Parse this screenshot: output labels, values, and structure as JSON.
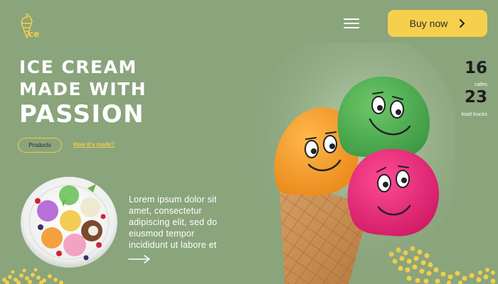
{
  "header": {
    "logo_text": "ce",
    "menu_icon": "hamburger-menu-icon",
    "buy_label": "Buy now",
    "buy_icon": "chevron-right-icon"
  },
  "hero": {
    "title_line1": "ICE CREAM",
    "title_line2": "MADE WITH",
    "title_line3": "PASSION",
    "products_label": "Products",
    "how_label": "How it's made?"
  },
  "stats": [
    {
      "value": "16",
      "label": "cafes"
    },
    {
      "value": "23",
      "label": "food trucks"
    }
  ],
  "description": "Lorem ipsum dolor sit amet, consectetur adipiscing elit, sed do eiusmod tempor incididunt ut labore et",
  "arrow_icon": "arrow-right-icon",
  "colors": {
    "background": "#8aa47c",
    "accent_yellow": "#f6d04d",
    "scoop_orange": "#f5a02c",
    "scoop_green": "#56b255",
    "scoop_pink": "#e8307a"
  }
}
